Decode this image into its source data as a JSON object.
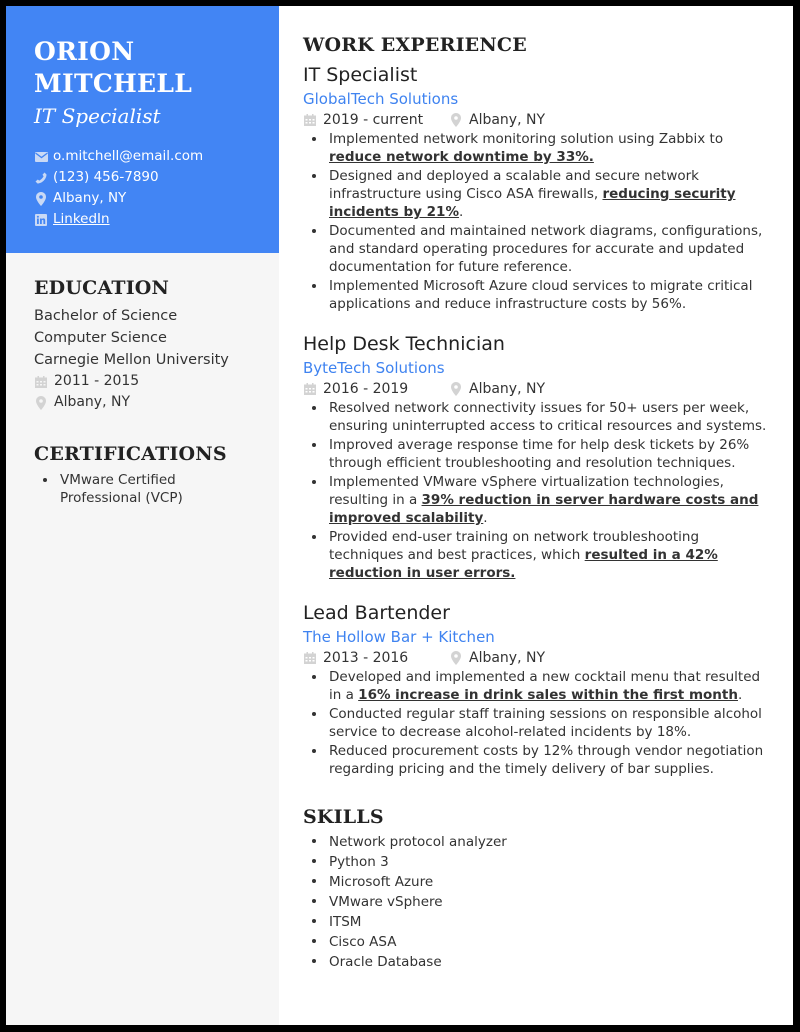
{
  "header": {
    "name_line1": "ORION",
    "name_line2": "MITCHELL",
    "title": "IT Specialist",
    "contacts": [
      {
        "icon": "envelope-icon",
        "text": "o.mitchell@email.com"
      },
      {
        "icon": "phone-icon",
        "text": "(123) 456-7890"
      },
      {
        "icon": "map-pin-icon",
        "text": "Albany, NY"
      },
      {
        "icon": "linkedin-icon",
        "text": "LinkedIn"
      }
    ]
  },
  "colors": {
    "accent": "#4285f4",
    "link": "#3f83f0",
    "sidebar_bg": "#f6f6f6"
  },
  "education": {
    "heading": "EDUCATION",
    "degree": "Bachelor of Science",
    "field": "Computer Science",
    "school": "Carnegie Mellon University",
    "dates": "2011 - 2015",
    "location": "Albany, NY"
  },
  "certifications": {
    "heading": "CERTIFICATIONS",
    "items": [
      "VMware Certified Professional (VCP)"
    ]
  },
  "work": {
    "heading": "WORK EXPERIENCE",
    "jobs": [
      {
        "title": "IT Specialist",
        "company": "GlobalTech Solutions",
        "dates": "2019 - current",
        "location": "Albany, NY",
        "bullets": [
          {
            "pre": "Implemented network monitoring solution using Zabbix to ",
            "em": "reduce network downtime by 33%.",
            "post": ""
          },
          {
            "pre": "Designed and deployed a scalable and secure network infrastructure using Cisco ASA firewalls, ",
            "em": "reducing security incidents by 21%",
            "post": "."
          },
          {
            "pre": "Documented and maintained network diagrams, configurations, and standard operating procedures for accurate and updated documentation for future reference.",
            "em": "",
            "post": ""
          },
          {
            "pre": "Implemented Microsoft Azure cloud services to migrate critical applications and reduce infrastructure costs by 56%.",
            "em": "",
            "post": ""
          }
        ]
      },
      {
        "title": "Help Desk Technician",
        "company": "ByteTech Solutions",
        "dates": "2016 - 2019",
        "location": "Albany, NY",
        "bullets": [
          {
            "pre": "Resolved network connectivity issues for 50+ users per week, ensuring uninterrupted access to critical resources and systems.",
            "em": "",
            "post": ""
          },
          {
            "pre": "Improved average response time for help desk tickets by 26% through efficient troubleshooting and resolution techniques.",
            "em": "",
            "post": ""
          },
          {
            "pre": "Implemented VMware vSphere virtualization technologies, resulting in a ",
            "em": "39% reduction in server hardware costs and improved scalability",
            "post": "."
          },
          {
            "pre": "Provided end-user training on network troubleshooting techniques and best practices, which ",
            "em": "resulted in a 42% reduction in user errors.",
            "post": ""
          }
        ]
      },
      {
        "title": "Lead Bartender",
        "company": "The Hollow Bar + Kitchen",
        "dates": "2013 - 2016",
        "location": "Albany, NY",
        "bullets": [
          {
            "pre": "Developed and implemented a new cocktail menu that resulted in a ",
            "em": "16% increase in drink sales within the first month",
            "post": "."
          },
          {
            "pre": "Conducted regular staff training sessions on responsible alcohol service to decrease alcohol-related incidents by 18%.",
            "em": "",
            "post": ""
          },
          {
            "pre": "Reduced procurement costs by 12% through vendor negotiation regarding pricing and the timely delivery of bar supplies.",
            "em": "",
            "post": ""
          }
        ]
      }
    ]
  },
  "skills": {
    "heading": "SKILLS",
    "items": [
      "Network protocol analyzer",
      "Python 3",
      "Microsoft Azure",
      "VMware vSphere",
      "ITSM",
      "Cisco ASA",
      "Oracle Database"
    ]
  }
}
